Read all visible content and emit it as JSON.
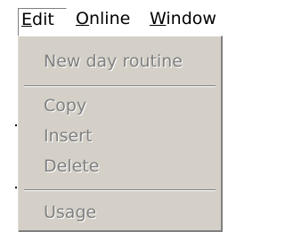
{
  "menubar": {
    "items": [
      {
        "hotkey": "E",
        "rest": "dit"
      },
      {
        "hotkey": "O",
        "rest": "nline"
      },
      {
        "hotkey": "W",
        "rest": "indow"
      }
    ]
  },
  "edit_menu": {
    "items": [
      {
        "label": "New day routine",
        "enabled": false
      },
      {
        "label": "Copy",
        "enabled": false
      },
      {
        "label": "Insert",
        "enabled": false
      },
      {
        "label": "Delete",
        "enabled": false
      },
      {
        "label": "Usage",
        "enabled": false
      }
    ]
  },
  "colors": {
    "menu_bg": "#d4d0c8",
    "disabled_text": "#808080",
    "highlight": "#ffffff",
    "shadow": "#808080"
  }
}
